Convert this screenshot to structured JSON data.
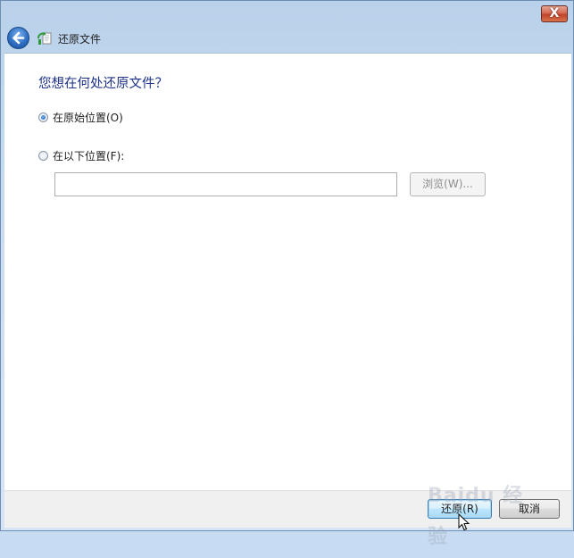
{
  "window": {
    "close_label": "X"
  },
  "nav": {
    "title": "还原文件",
    "back_icon": "back-arrow-icon",
    "app_icon": "restore-file-icon"
  },
  "main": {
    "heading": "您想在何处还原文件？",
    "options": [
      {
        "label": "在原始位置(O)",
        "checked": true
      },
      {
        "label": "在以下位置(F):",
        "checked": false
      }
    ],
    "path_input": {
      "value": "",
      "placeholder": ""
    },
    "browse_label": "浏览(W)..."
  },
  "footer": {
    "restore_label": "还原(R)",
    "cancel_label": "取消"
  },
  "watermark": {
    "text": "Baidu 经验"
  },
  "colors": {
    "heading": "#1e3287",
    "accent": "#3c7fb1",
    "close": "#c0412a"
  }
}
